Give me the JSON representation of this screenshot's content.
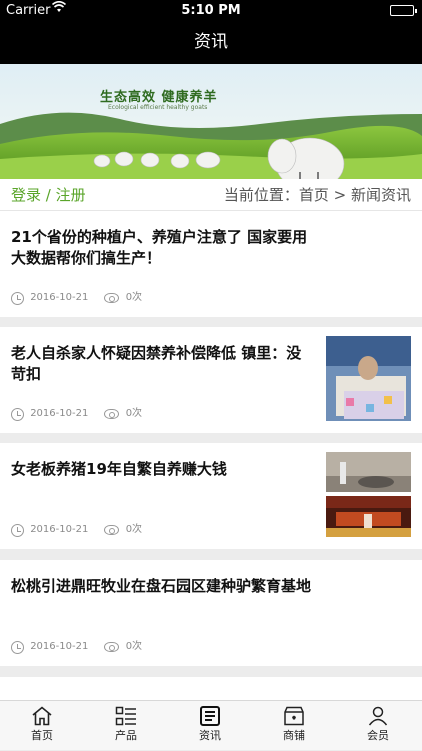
{
  "status": {
    "carrier": "Carrier",
    "time": "5:10 PM"
  },
  "nav": {
    "title": "资讯"
  },
  "banner": {
    "headline": "生态高效 健康养羊",
    "subline": "Ecological efficient healthy goats"
  },
  "locbar": {
    "login": "登录",
    "sep": " / ",
    "register": "注册",
    "location": "当前位置：首页 > 新闻资讯"
  },
  "articles": [
    {
      "title": "21个省份的种植户、养殖户注意了 国家要用大数据帮你们搞生产！",
      "date": "2016-10-21",
      "views": "0次",
      "has_thumb": false
    },
    {
      "title": "老人自杀家人怀疑因禁养补偿降低 镇里：没苛扣",
      "date": "2016-10-21",
      "views": "0次",
      "has_thumb": true
    },
    {
      "title": "女老板养猪19年自繁自养赚大钱",
      "date": "2016-10-21",
      "views": "0次",
      "has_thumb": true
    },
    {
      "title": "松桃引进鼎旺牧业在盘石园区建种驴繁育基地",
      "date": "2016-10-21",
      "views": "0次",
      "has_thumb": false
    }
  ],
  "tabs": [
    {
      "label": "首页",
      "icon": "home-icon"
    },
    {
      "label": "产品",
      "icon": "list-icon"
    },
    {
      "label": "资讯",
      "icon": "news-icon"
    },
    {
      "label": "商铺",
      "icon": "shop-icon"
    },
    {
      "label": "会员",
      "icon": "user-icon"
    }
  ]
}
